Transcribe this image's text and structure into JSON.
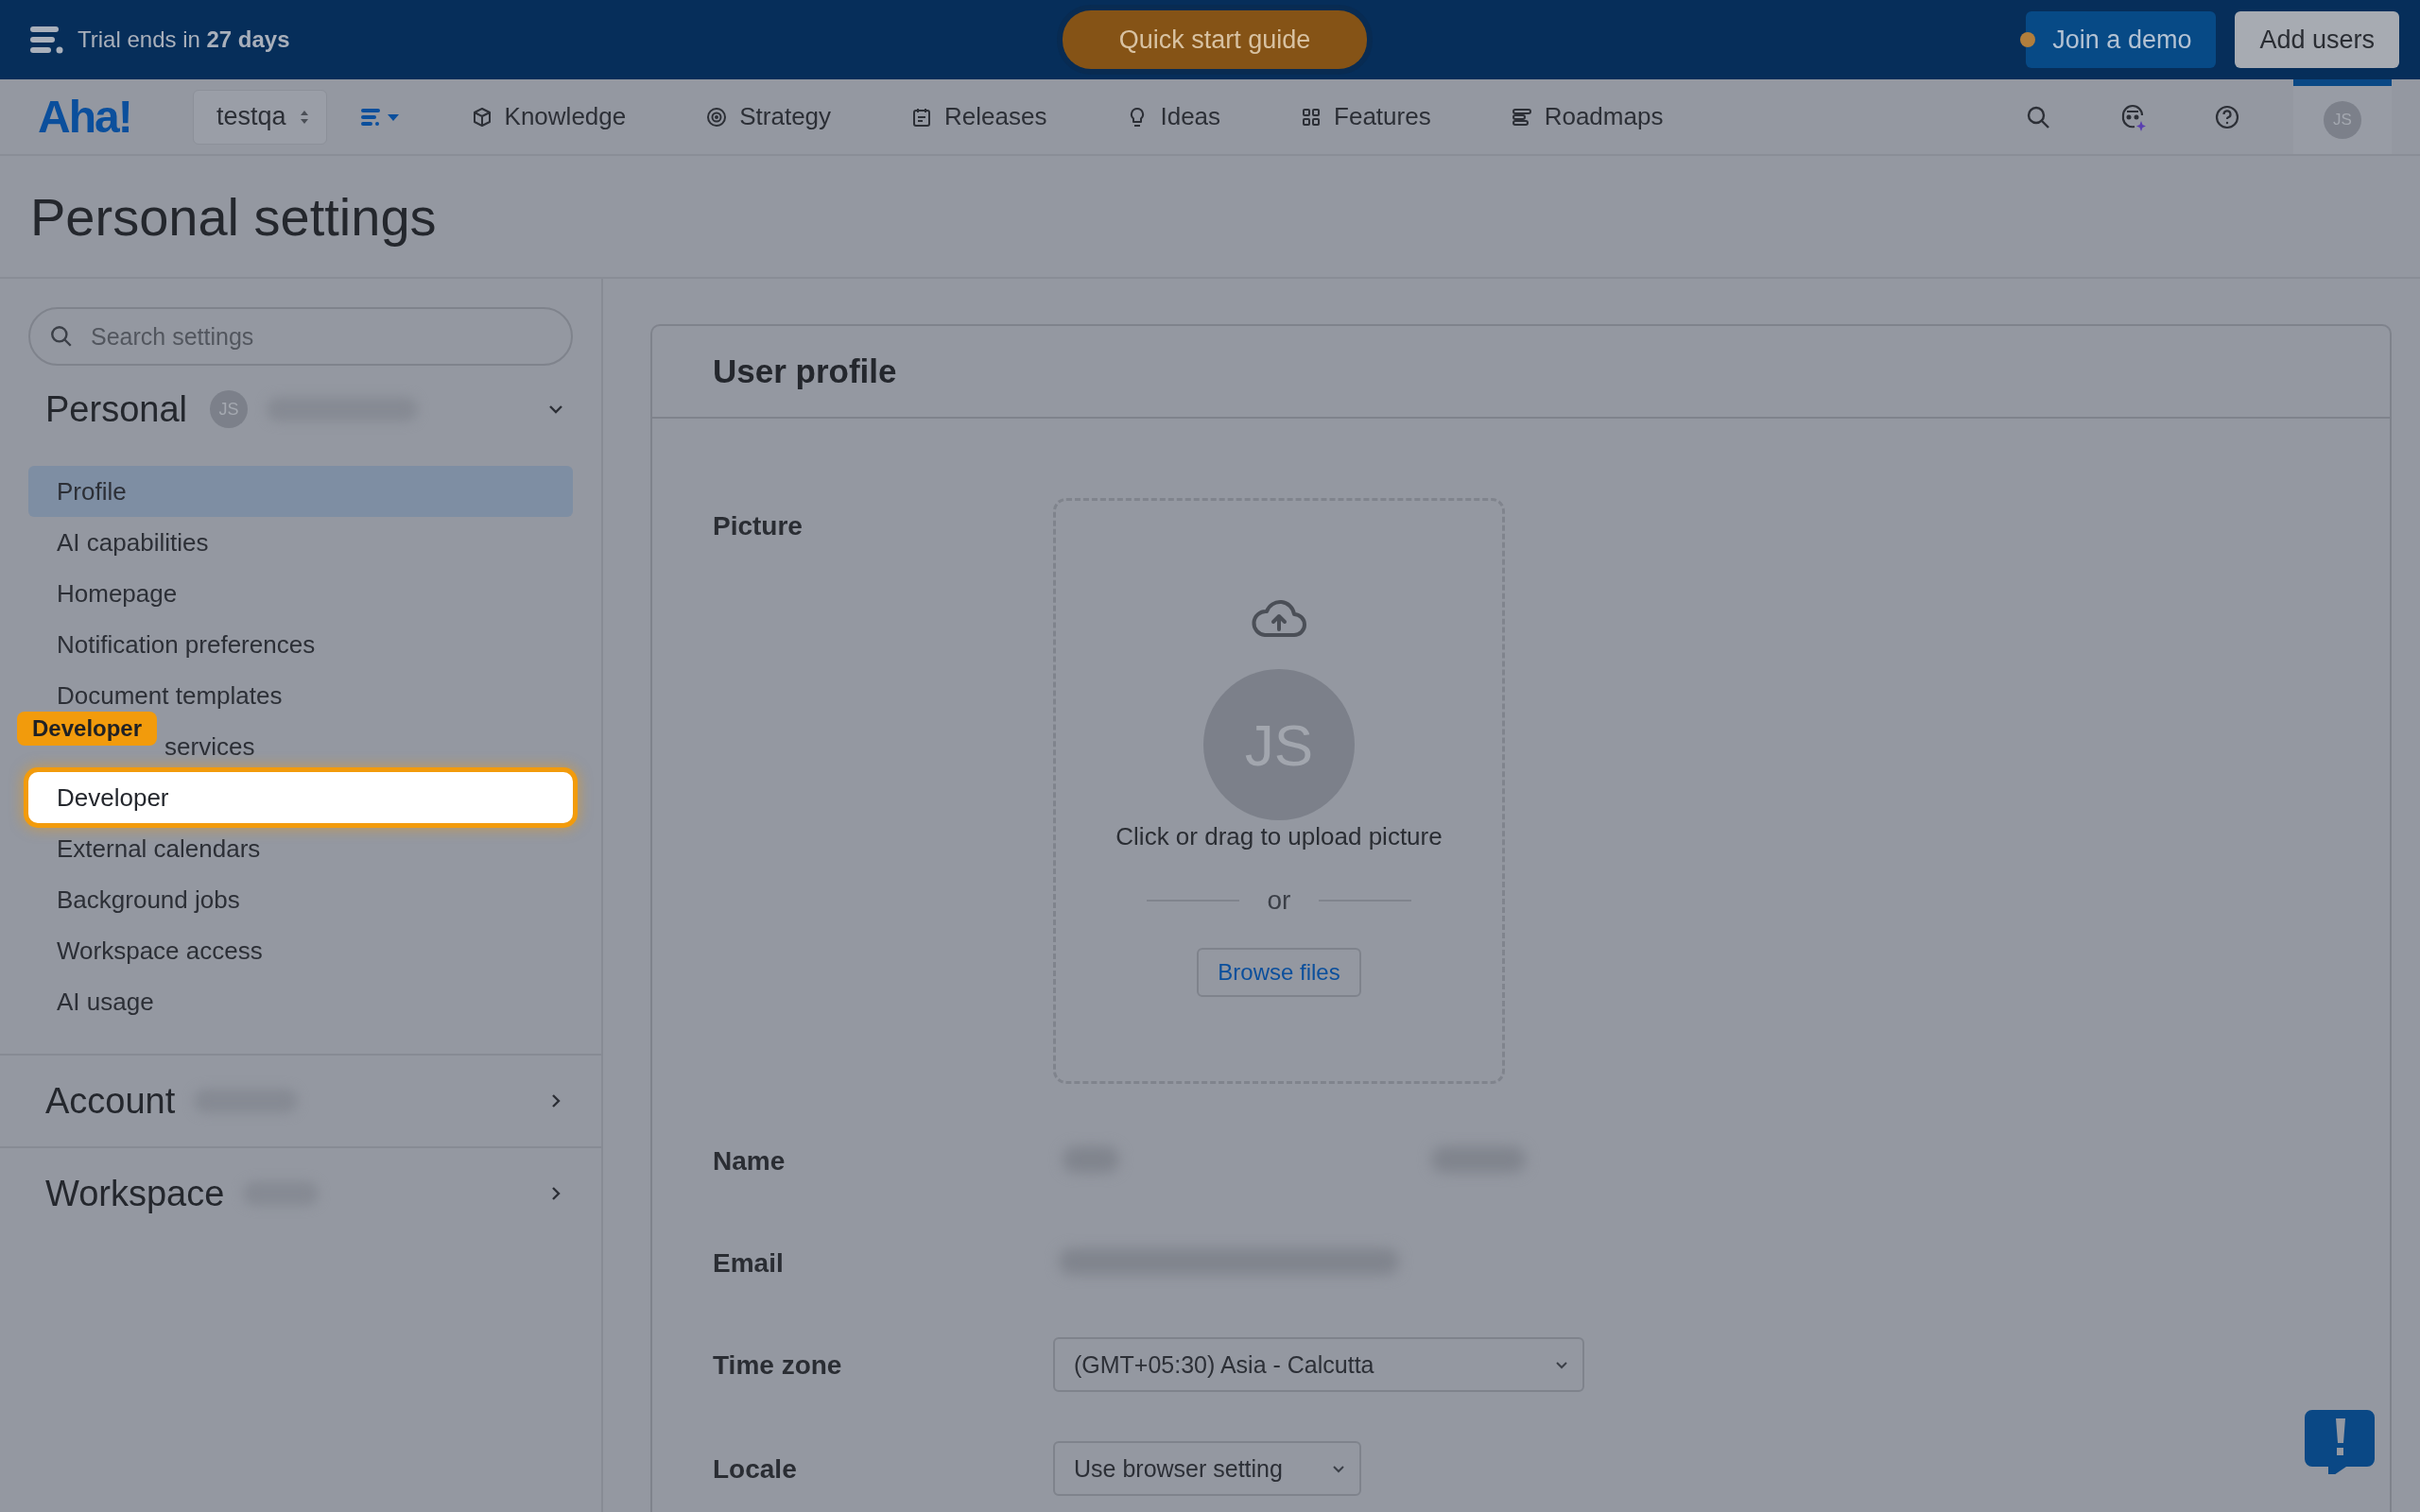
{
  "banner": {
    "trial_text": "Trial ends in **27 days**",
    "quick_start": "Quick start guide",
    "join_demo": "Join a demo",
    "add_users": "Add users"
  },
  "nav": {
    "logo": "Aha!",
    "workspace": "testqa",
    "items": [
      {
        "label": "Knowledge"
      },
      {
        "label": "Strategy"
      },
      {
        "label": "Releases"
      },
      {
        "label": "Ideas"
      },
      {
        "label": "Features"
      },
      {
        "label": "Roadmaps"
      }
    ],
    "avatar": "JS"
  },
  "page_title": "Personal settings",
  "sidebar": {
    "search_placeholder": "Search settings",
    "sections": [
      {
        "title": "Personal",
        "avatar": "JS",
        "expanded": true,
        "items": [
          {
            "label": "Profile",
            "selected": true,
            "highlighted": false
          },
          {
            "label": "AI capabilities",
            "selected": false,
            "highlighted": false
          },
          {
            "label": "Homepage",
            "selected": false,
            "highlighted": false
          },
          {
            "label": "Notification preferences",
            "selected": false,
            "highlighted": false
          },
          {
            "label": "Document templates",
            "selected": false,
            "highlighted": false
          },
          {
            "label": "services",
            "selected": false,
            "highlighted": false
          },
          {
            "label": "Developer",
            "selected": false,
            "highlighted": true
          },
          {
            "label": "External calendars",
            "selected": false,
            "highlighted": false
          },
          {
            "label": "Background jobs",
            "selected": false,
            "highlighted": false
          },
          {
            "label": "Workspace access",
            "selected": false,
            "highlighted": false
          },
          {
            "label": "AI usage",
            "selected": false,
            "highlighted": false
          }
        ]
      },
      {
        "title": "Account",
        "expanded": false
      },
      {
        "title": "Workspace",
        "expanded": false
      }
    ]
  },
  "tour_tag": "Developer",
  "profile": {
    "title": "User profile",
    "fields": [
      {
        "kind": "picture",
        "label": "Picture",
        "avatar": "JS",
        "prompt": "Click or drag to upload picture",
        "divider": "or",
        "button": "Browse files"
      },
      {
        "kind": "name",
        "label": "Name"
      },
      {
        "kind": "email",
        "label": "Email"
      },
      {
        "kind": "select",
        "label": "Time zone",
        "value": "(GMT+05:30) Asia - Calcutta",
        "wide": true
      },
      {
        "kind": "select",
        "label": "Locale",
        "value": "Use browser setting",
        "wide": false
      }
    ]
  }
}
